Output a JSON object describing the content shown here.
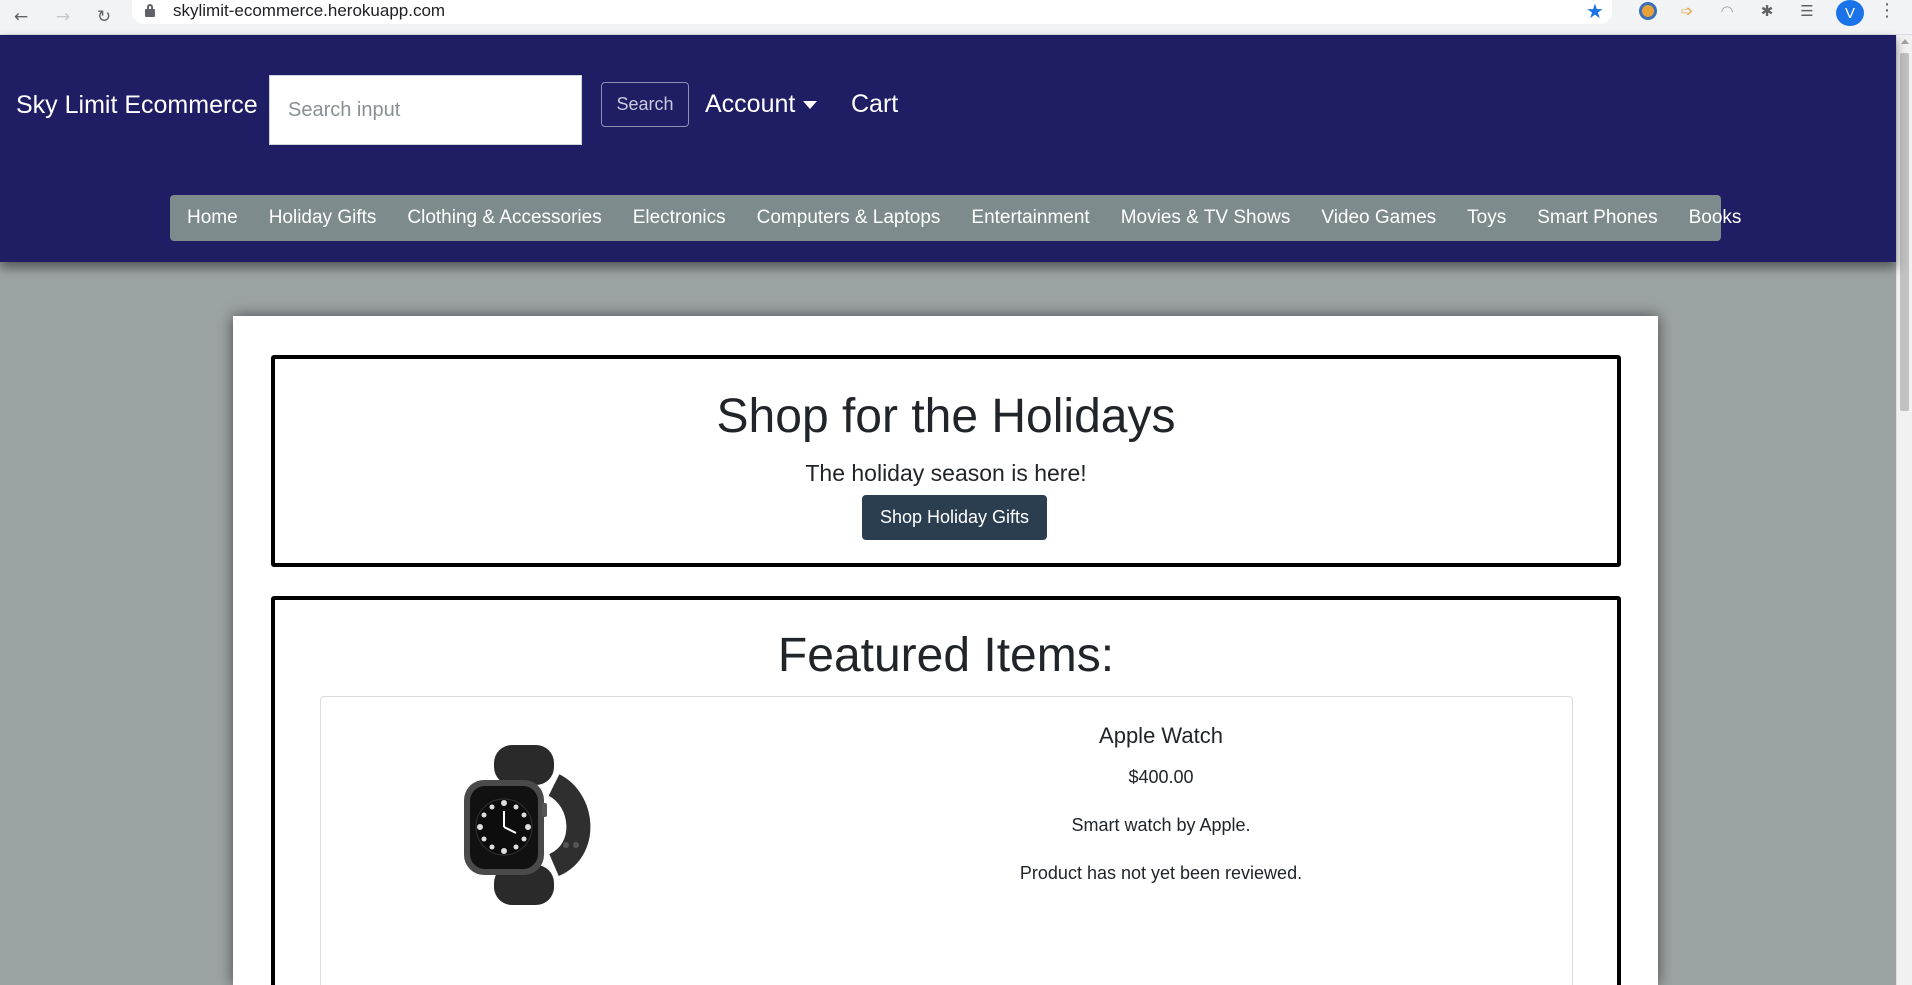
{
  "browser": {
    "url": "skylimit-ecommerce.herokuapp.com",
    "back_icon": "←",
    "forward_icon": "→",
    "reload_icon": "↻",
    "star_icon": "★",
    "extensions_icon": "✱",
    "menu_icon": "⋮",
    "profile_initial": "V"
  },
  "header": {
    "brand": "Sky Limit Ecommerce",
    "search_placeholder": "Search input",
    "search_button": "Search",
    "account_label": "Account",
    "cart_label": "Cart"
  },
  "categories": [
    "Home",
    "Holiday Gifts",
    "Clothing & Accessories",
    "Electronics",
    "Computers & Laptops",
    "Entertainment",
    "Movies & TV Shows",
    "Video Games",
    "Toys",
    "Smart Phones",
    "Books"
  ],
  "hero": {
    "title": "Shop for the Holidays",
    "subtitle": "The holiday season is here!",
    "button": "Shop Holiday Gifts"
  },
  "featured": {
    "title": "Featured Items:",
    "items": [
      {
        "name": "Apple Watch",
        "price": "$400.00",
        "description": "Smart watch by Apple.",
        "review": "Product has not yet been reviewed."
      }
    ]
  },
  "colors": {
    "header_bg": "#1f1d63",
    "category_bar": "#7d8b8c",
    "page_bg": "#9ca3a3",
    "hero_button": "#2b3e50"
  }
}
